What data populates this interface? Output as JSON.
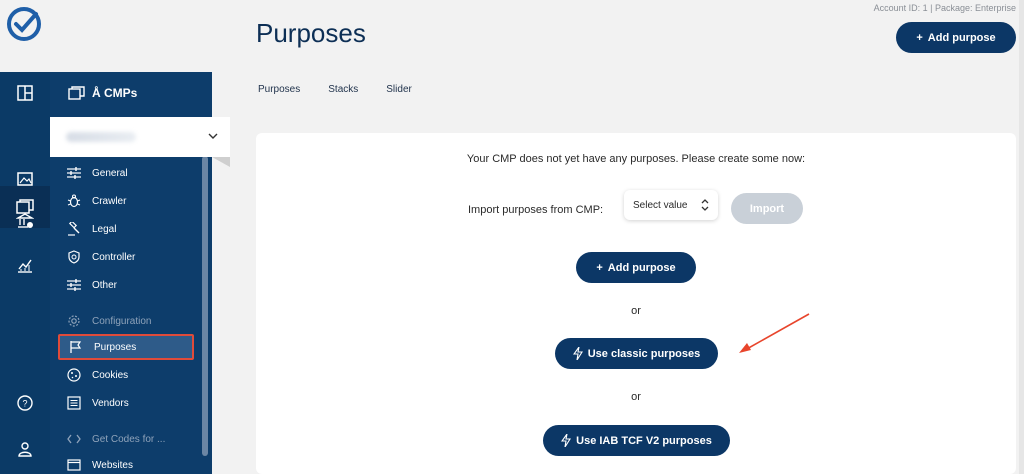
{
  "account": {
    "info": "Account ID: 1 | Package: Enterprise"
  },
  "header": {
    "title": "Purposes",
    "add_button": "Add purpose"
  },
  "tabs": [
    {
      "label": "Purposes"
    },
    {
      "label": "Stacks"
    },
    {
      "label": "Slider"
    }
  ],
  "nav": {
    "title": "Å CMPs",
    "items": [
      {
        "label": "General",
        "icon": "sliders-icon"
      },
      {
        "label": "Crawler",
        "icon": "bug-icon"
      },
      {
        "label": "Legal",
        "icon": "gavel-icon"
      },
      {
        "label": "Controller",
        "icon": "shield-icon"
      },
      {
        "label": "Other",
        "icon": "sliders-icon"
      },
      {
        "label": "Configuration",
        "icon": "gear-icon"
      },
      {
        "label": "Purposes",
        "icon": "flag-icon"
      },
      {
        "label": "Cookies",
        "icon": "cookie-icon"
      },
      {
        "label": "Vendors",
        "icon": "list-icon"
      },
      {
        "label": "Get Codes for ...",
        "icon": "code-icon"
      },
      {
        "label": "Websites",
        "icon": "window-icon"
      }
    ]
  },
  "rail": {
    "icons": [
      "dashboard-icon",
      "cmp-icon",
      "image-icon",
      "bank-icon",
      "chart-icon",
      "help-icon",
      "user-icon"
    ]
  },
  "main": {
    "empty_message": "Your CMP does not yet have any purposes. Please create some now:",
    "import_label": "Import purposes from CMP:",
    "select_value": "Select value",
    "import_button": "Import",
    "add_purpose_button": "Add purpose",
    "or_1": "or",
    "classic_button": "Use classic purposes",
    "or_2": "or",
    "iab_button": "Use IAB TCF V2 purposes"
  },
  "colors": {
    "primary": "#0c3766",
    "sidebar": "#0d3d6b",
    "highlight_border": "#e04b3a",
    "arrow": "#e8452c"
  }
}
